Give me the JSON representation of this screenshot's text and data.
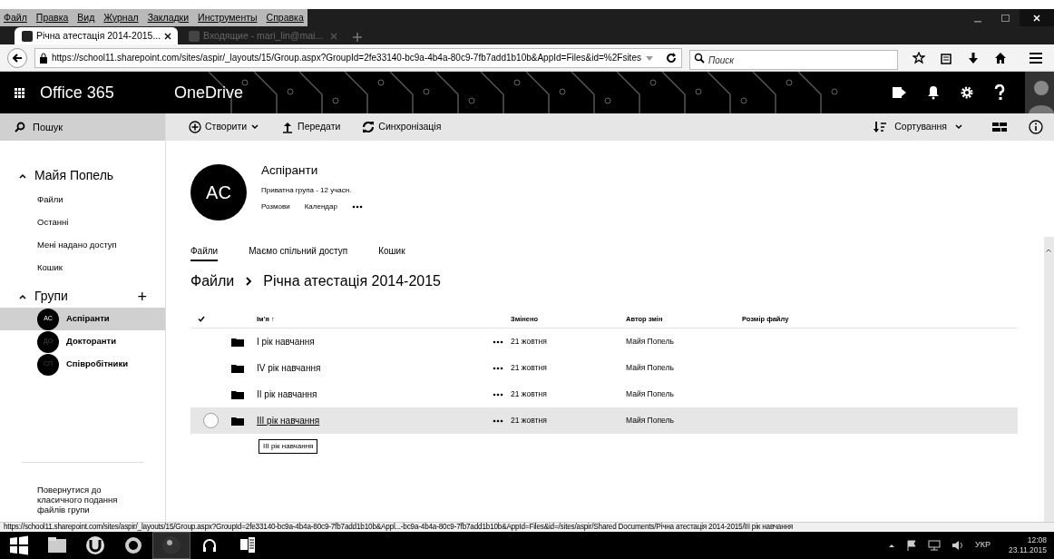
{
  "browser": {
    "menu": [
      "Файл",
      "Правка",
      "Вид",
      "Журнал",
      "Закладки",
      "Инструменты",
      "Справка"
    ],
    "tabs": [
      {
        "title": "Річна атестація 2014-2015...",
        "selected": true
      },
      {
        "title": "Входящие - mari_lin@mai...",
        "selected": false
      }
    ],
    "url": "https://school11.sharepoint.com/sites/aspir/_layouts/15/Group.aspx?GroupId=2fe33140-bc9a-4b4a-80c9-7fb7add1b10b&AppId=Files&id=%2Fsites",
    "search_placeholder": "Поиск"
  },
  "header": {
    "brand": "Office 365",
    "app": "OneDrive"
  },
  "sidebar": {
    "search": "Пошук",
    "user": {
      "title": "Майя Попель",
      "expanded": true,
      "items": [
        "Файли",
        "Останні",
        "Мені надано доступ",
        "Кошик"
      ]
    },
    "groups": {
      "title": "Групи",
      "expanded": true,
      "add": "+",
      "items": [
        {
          "initials": "AC",
          "name": "Аспіранти",
          "selected": true
        },
        {
          "initials": "ДО",
          "name": "Докторанти",
          "selected": false
        },
        {
          "initials": "СП",
          "name": "Співробітники",
          "selected": false
        }
      ]
    },
    "footer_link": "Повернутися до класичного подання файлів групи"
  },
  "commands": [
    {
      "kind": "create",
      "label": "Створити"
    },
    {
      "kind": "upload",
      "label": "Передати"
    },
    {
      "kind": "sync",
      "label": "Синхронізація"
    }
  ],
  "sort": "Сортування",
  "group": {
    "initials": "AC",
    "name": "Аспіранти",
    "subtitle": "Приватна група - 12 учасн.",
    "links": [
      "Розмови",
      "Календар"
    ]
  },
  "view_tabs": [
    {
      "label": "Файли",
      "selected": true
    },
    {
      "label": "Маємо спільний доступ",
      "selected": false
    },
    {
      "label": "Кошик",
      "selected": false
    }
  ],
  "breadcrumb": [
    "Файли",
    "Річна атестація 2014-2015"
  ],
  "table": {
    "columns": [
      "Ім'я ↑",
      "Змінено",
      "Автор змін",
      "Розмір файлу"
    ],
    "rows": [
      {
        "name": "I рік навчання",
        "modified": "21 жовтня",
        "author": "Майя Попель",
        "hovered": false
      },
      {
        "name": "IV рік навчання",
        "modified": "21 жовтня",
        "author": "Майя Попель",
        "hovered": false
      },
      {
        "name": "II рік навчання",
        "modified": "21 жовтня",
        "author": "Майя Попель",
        "hovered": false
      },
      {
        "name": "III рік навчання",
        "modified": "21 жовтня",
        "author": "Майя Попель",
        "hovered": true
      }
    ]
  },
  "tooltip": "III рік навчання",
  "status_url": "https://school11.sharepoint.com/sites/aspir/_layouts/15/Group.aspx?GroupId=2fe33140-bc9a-4b4a-80c9-7fb7add1b10b&Appl...-bc9a-4b4a-80c9-7fb7add1b10b&AppId=Files&id=/sites/aspir/Shared Documents/Річна атестація 2014-2015/III рік навчання",
  "taskbar": {
    "language": "УКР",
    "time": "12:08",
    "date": "23.11.2015"
  }
}
